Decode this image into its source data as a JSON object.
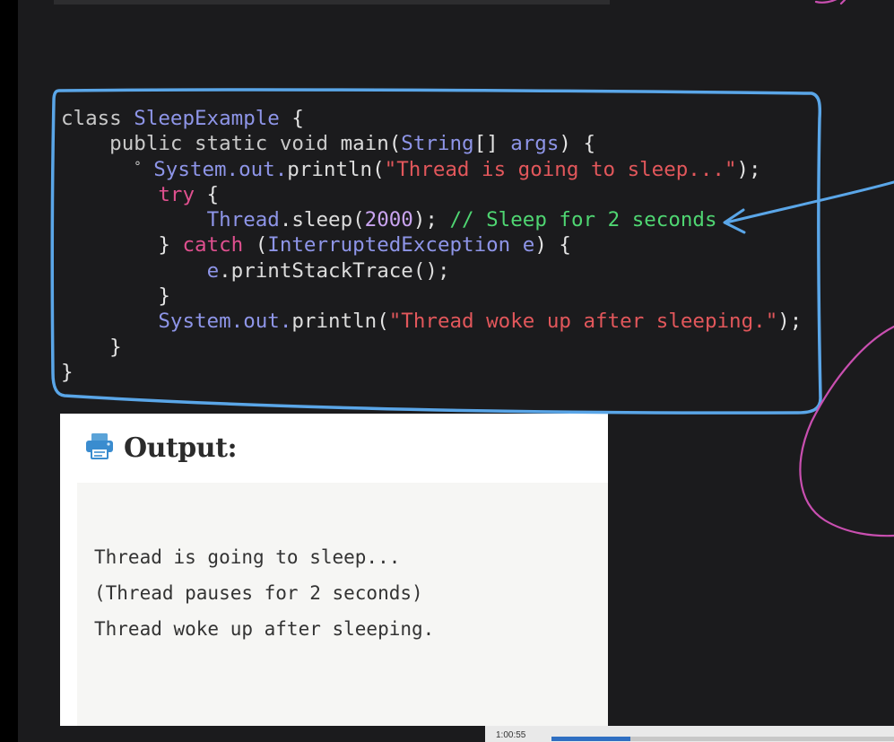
{
  "code": {
    "lines": [
      [
        {
          "t": "class ",
          "c": "kw"
        },
        {
          "t": "SleepExample",
          "c": "cls"
        },
        {
          "t": " {",
          "c": "punct"
        }
      ],
      [
        {
          "t": "    public static void ",
          "c": "kw"
        },
        {
          "t": "main",
          "c": "fn"
        },
        {
          "t": "(",
          "c": "punct"
        },
        {
          "t": "String",
          "c": "cls"
        },
        {
          "t": "[] ",
          "c": "punct"
        },
        {
          "t": "args",
          "c": "cls"
        },
        {
          "t": ") {",
          "c": "punct"
        }
      ],
      [
        {
          "t": "      ",
          "c": "punct"
        },
        {
          "t": "°",
          "c": "bullet"
        },
        {
          "t": " ",
          "c": "punct"
        },
        {
          "t": "System",
          "c": "cls"
        },
        {
          "t": ".out.",
          "c": "cls"
        },
        {
          "t": "println",
          "c": "fn"
        },
        {
          "t": "(",
          "c": "punct"
        },
        {
          "t": "\"Thread is going to sleep...\"",
          "c": "str"
        },
        {
          "t": ");",
          "c": "punct"
        }
      ],
      [
        {
          "t": "        ",
          "c": "punct"
        },
        {
          "t": "try",
          "c": "kw2"
        },
        {
          "t": " {",
          "c": "punct"
        }
      ],
      [
        {
          "t": "            ",
          "c": "punct"
        },
        {
          "t": "Thread",
          "c": "cls"
        },
        {
          "t": ".sleep(",
          "c": "fn"
        },
        {
          "t": "2000",
          "c": "num"
        },
        {
          "t": "); ",
          "c": "punct"
        },
        {
          "t": "// Sleep for 2 seconds",
          "c": "cmt"
        }
      ],
      [
        {
          "t": "        } ",
          "c": "punct"
        },
        {
          "t": "catch",
          "c": "kw2"
        },
        {
          "t": " (",
          "c": "punct"
        },
        {
          "t": "InterruptedException",
          "c": "cls"
        },
        {
          "t": " ",
          "c": "punct"
        },
        {
          "t": "e",
          "c": "cls"
        },
        {
          "t": ") {",
          "c": "punct"
        }
      ],
      [
        {
          "t": "            ",
          "c": "punct"
        },
        {
          "t": "e",
          "c": "cls"
        },
        {
          "t": ".printStackTrace();",
          "c": "fn"
        }
      ],
      [
        {
          "t": "        }",
          "c": "punct"
        }
      ],
      [
        {
          "t": "        ",
          "c": "punct"
        },
        {
          "t": "System",
          "c": "cls"
        },
        {
          "t": ".out.",
          "c": "cls"
        },
        {
          "t": "println",
          "c": "fn"
        },
        {
          "t": "(",
          "c": "punct"
        },
        {
          "t": "\"Thread woke up after sleeping.\"",
          "c": "str"
        },
        {
          "t": ");",
          "c": "punct"
        }
      ],
      [
        {
          "t": "    }",
          "c": "punct"
        }
      ],
      [
        {
          "t": "}",
          "c": "punct"
        }
      ]
    ]
  },
  "output": {
    "icon": "printer-icon",
    "title": "Output:",
    "lines": [
      "Thread is going to sleep...",
      "(Thread pauses for 2 seconds)",
      "Thread woke up after sleeping."
    ]
  },
  "player": {
    "timestamp": "1:00:55",
    "progress": 0.23
  },
  "colors": {
    "background": "#1b1b1d",
    "annotation_blue": "#5aa6e8",
    "annotation_pink": "#c94fb0",
    "progress_blue": "#2f6fc2"
  }
}
